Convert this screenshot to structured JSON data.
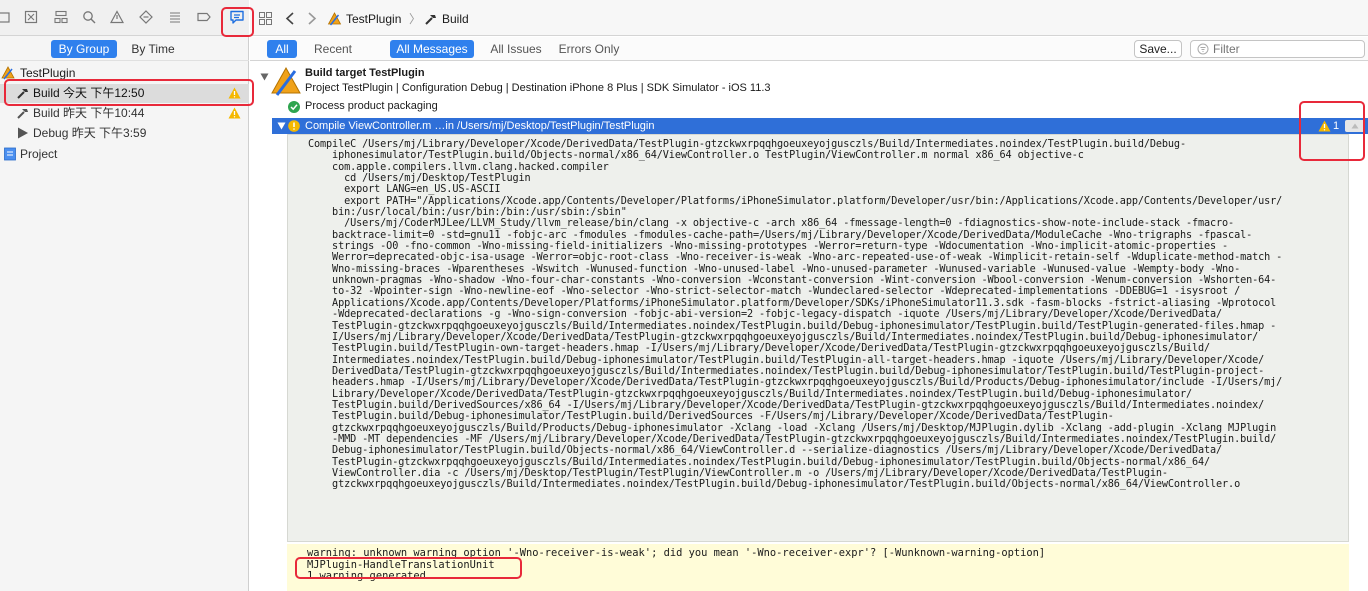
{
  "nav": {
    "tabs": [
      "project-navigator",
      "source-control",
      "symbol-navigator",
      "find-navigator",
      "issue-navigator",
      "test-navigator",
      "debug-navigator",
      "breakpoint-navigator",
      "report-navigator"
    ],
    "by_group": "By Group",
    "by_time": "By Time",
    "tree": {
      "root_label": "TestPlugin",
      "items": [
        {
          "label": "Build 今天 下午12:50",
          "icon": "hammer-icon",
          "warning": true
        },
        {
          "label": "Build 昨天 下午10:44",
          "icon": "hammer-icon",
          "warning": true
        },
        {
          "label": "Debug 昨天 下午3:59",
          "icon": "play-icon",
          "warning": false
        },
        {
          "label": "Project",
          "icon": "project-file-icon",
          "warning": false
        }
      ]
    }
  },
  "jumpbar": {
    "project": "TestPlugin",
    "sep": "〉",
    "current": "Build"
  },
  "filters": {
    "all": "All",
    "recent": "Recent",
    "all_messages": "All Messages",
    "all_issues": "All Issues",
    "errors_only": "Errors Only",
    "save": "Save...",
    "filter_placeholder": "Filter"
  },
  "log": {
    "build_target": "Build target TestPlugin",
    "build_meta": "Project TestPlugin | Configuration Debug | Destination iPhone 8 Plus | SDK Simulator - iOS 11.3",
    "process": "Process product packaging",
    "compile": "Compile ViewController.m …in /Users/mj/Desktop/TestPlugin/TestPlugin",
    "warning_count": "1",
    "command": "CompileC /Users/mj/Library/Developer/Xcode/DerivedData/TestPlugin-gtzckwxrpqqhgoeuxeyojgusczls/Build/Intermediates.noindex/TestPlugin.build/Debug-\n    iphonesimulator/TestPlugin.build/Objects-normal/x86_64/ViewController.o TestPlugin/ViewController.m normal x86_64 objective-c\n    com.apple.compilers.llvm.clang.hacked.compiler\n      cd /Users/mj/Desktop/TestPlugin\n      export LANG=en_US.US-ASCII\n      export PATH=\"/Applications/Xcode.app/Contents/Developer/Platforms/iPhoneSimulator.platform/Developer/usr/bin:/Applications/Xcode.app/Contents/Developer/usr/\n    bin:/usr/local/bin:/usr/bin:/bin:/usr/sbin:/sbin\"\n      /Users/mj/CoderMJLee/LLVM_Study/llvm_release/bin/clang -x objective-c -arch x86_64 -fmessage-length=0 -fdiagnostics-show-note-include-stack -fmacro-\n    backtrace-limit=0 -std=gnu11 -fobjc-arc -fmodules -fmodules-cache-path=/Users/mj/Library/Developer/Xcode/DerivedData/ModuleCache -Wno-trigraphs -fpascal-\n    strings -O0 -fno-common -Wno-missing-field-initializers -Wno-missing-prototypes -Werror=return-type -Wdocumentation -Wno-implicit-atomic-properties -\n    Werror=deprecated-objc-isa-usage -Werror=objc-root-class -Wno-receiver-is-weak -Wno-arc-repeated-use-of-weak -Wimplicit-retain-self -Wduplicate-method-match -\n    Wno-missing-braces -Wparentheses -Wswitch -Wunused-function -Wno-unused-label -Wno-unused-parameter -Wunused-variable -Wunused-value -Wempty-body -Wno-\n    unknown-pragmas -Wno-shadow -Wno-four-char-constants -Wno-conversion -Wconstant-conversion -Wint-conversion -Wbool-conversion -Wenum-conversion -Wshorten-64-\n    to-32 -Wpointer-sign -Wno-newline-eof -Wno-selector -Wno-strict-selector-match -Wundeclared-selector -Wdeprecated-implementations -DDEBUG=1 -isysroot /\n    Applications/Xcode.app/Contents/Developer/Platforms/iPhoneSimulator.platform/Developer/SDKs/iPhoneSimulator11.3.sdk -fasm-blocks -fstrict-aliasing -Wprotocol\n    -Wdeprecated-declarations -g -Wno-sign-conversion -fobjc-abi-version=2 -fobjc-legacy-dispatch -iquote /Users/mj/Library/Developer/Xcode/DerivedData/\n    TestPlugin-gtzckwxrpqqhgoeuxeyojgusczls/Build/Intermediates.noindex/TestPlugin.build/Debug-iphonesimulator/TestPlugin.build/TestPlugin-generated-files.hmap -\n    I/Users/mj/Library/Developer/Xcode/DerivedData/TestPlugin-gtzckwxrpqqhgoeuxeyojgusczls/Build/Intermediates.noindex/TestPlugin.build/Debug-iphonesimulator/\n    TestPlugin.build/TestPlugin-own-target-headers.hmap -I/Users/mj/Library/Developer/Xcode/DerivedData/TestPlugin-gtzckwxrpqqhgoeuxeyojgusczls/Build/\n    Intermediates.noindex/TestPlugin.build/Debug-iphonesimulator/TestPlugin.build/TestPlugin-all-target-headers.hmap -iquote /Users/mj/Library/Developer/Xcode/\n    DerivedData/TestPlugin-gtzckwxrpqqhgoeuxeyojgusczls/Build/Intermediates.noindex/TestPlugin.build/Debug-iphonesimulator/TestPlugin.build/TestPlugin-project-\n    headers.hmap -I/Users/mj/Library/Developer/Xcode/DerivedData/TestPlugin-gtzckwxrpqqhgoeuxeyojgusczls/Build/Products/Debug-iphonesimulator/include -I/Users/mj/\n    Library/Developer/Xcode/DerivedData/TestPlugin-gtzckwxrpqqhgoeuxeyojgusczls/Build/Intermediates.noindex/TestPlugin.build/Debug-iphonesimulator/\n    TestPlugin.build/DerivedSources/x86_64 -I/Users/mj/Library/Developer/Xcode/DerivedData/TestPlugin-gtzckwxrpqqhgoeuxeyojgusczls/Build/Intermediates.noindex/\n    TestPlugin.build/Debug-iphonesimulator/TestPlugin.build/DerivedSources -F/Users/mj/Library/Developer/Xcode/DerivedData/TestPlugin-\n    gtzckwxrpqqhgoeuxeyojgusczls/Build/Products/Debug-iphonesimulator -Xclang -load -Xclang /Users/mj/Desktop/MJPlugin.dylib -Xclang -add-plugin -Xclang MJPlugin\n    -MMD -MT dependencies -MF /Users/mj/Library/Developer/Xcode/DerivedData/TestPlugin-gtzckwxrpqqhgoeuxeyojgusczls/Build/Intermediates.noindex/TestPlugin.build/\n    Debug-iphonesimulator/TestPlugin.build/Objects-normal/x86_64/ViewController.d --serialize-diagnostics /Users/mj/Library/Developer/Xcode/DerivedData/\n    TestPlugin-gtzckwxrpqqhgoeuxeyojgusczls/Build/Intermediates.noindex/TestPlugin.build/Debug-iphonesimulator/TestPlugin.build/Objects-normal/x86_64/\n    ViewController.dia -c /Users/mj/Desktop/TestPlugin/TestPlugin/ViewController.m -o /Users/mj/Library/Developer/Xcode/DerivedData/TestPlugin-\n    gtzckwxrpqqhgoeuxeyojgusczls/Build/Intermediates.noindex/TestPlugin.build/Debug-iphonesimulator/TestPlugin.build/Objects-normal/x86_64/ViewController.o",
    "output": "warning: unknown warning option '-Wno-receiver-is-weak'; did you mean '-Wno-receiver-expr'? [-Wunknown-warning-option]\nMJPlugin-HandleTranslationUnit\n1 warning generated."
  },
  "colors": {
    "accent": "#2f80ed",
    "selection_row": "#2f6fd8",
    "warning": "#f5b800",
    "annotation": "#e8293a",
    "output_bg": "#fffcd8",
    "detail_bg": "#eef0ec"
  }
}
